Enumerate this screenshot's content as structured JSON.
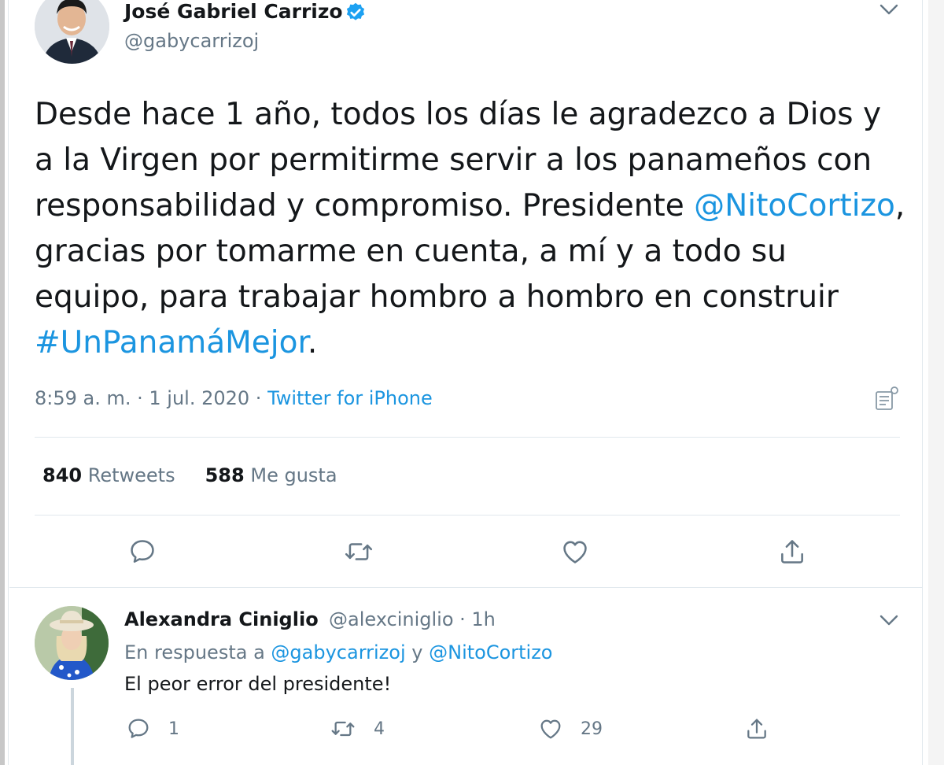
{
  "tweet": {
    "author_name": "José Gabriel Carrizo",
    "author_handle": "@gabycarrizoj",
    "verified_icon": "verified-badge-icon",
    "text_part1": "Desde hace 1 año, todos los días le agradezco a Dios y a la Virgen por permitirme servir a los panameños con responsabilidad y compromiso. Presidente ",
    "mention": "@NitoCortizo",
    "text_part2": ", gracias por tomarme en cuenta, a mí y a todo su equipo, para trabajar hombro a hombro en construir ",
    "hashtag": "#UnPanamáMejor",
    "text_part3": ".",
    "time": "8:59 a. m.",
    "date": "1 jul. 2020",
    "source": "Twitter for iPhone",
    "separator": " · ",
    "retweets_count": "840",
    "retweets_label": "Retweets",
    "likes_count": "588",
    "likes_label": "Me gusta"
  },
  "reply": {
    "author_name": "Alexandra Ciniglio",
    "author_handle": "@alexciniglio",
    "time": " · 1h",
    "reply_to_prefix": "En respuesta a ",
    "reply_to_user1": "@gabycarrizoj",
    "reply_to_conj": " y ",
    "reply_to_user2": "@NitoCortizo",
    "text": "El peor error del presidente!",
    "replies_count": "1",
    "retweets_count": "4",
    "likes_count": "29"
  },
  "colors": {
    "link": "#1b95e0",
    "secondary_text": "#657786",
    "primary_text": "#14171a",
    "verified": "#1da1f2"
  }
}
